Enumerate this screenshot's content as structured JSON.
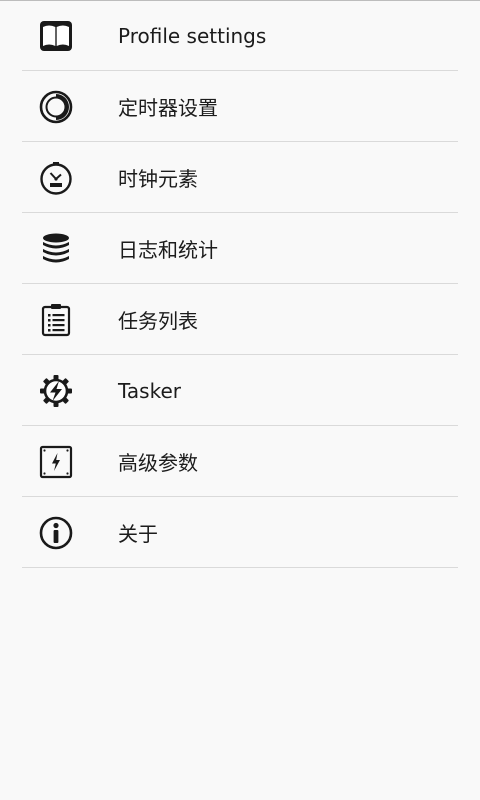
{
  "menu": {
    "items": [
      {
        "label": "Profile settings",
        "icon": "book-icon"
      },
      {
        "label": "定时器设置",
        "icon": "timer-icon"
      },
      {
        "label": "时钟元素",
        "icon": "clock-icon"
      },
      {
        "label": "日志和统计",
        "icon": "database-icon"
      },
      {
        "label": "任务列表",
        "icon": "clipboard-list-icon"
      },
      {
        "label": "Tasker",
        "icon": "tasker-gear-icon"
      },
      {
        "label": "高级参数",
        "icon": "power-panel-icon"
      },
      {
        "label": "关于",
        "icon": "info-icon"
      }
    ]
  },
  "colors": {
    "background": "#f9f9f9",
    "divider": "#dadada",
    "text": "#1c1c1c",
    "icon": "#1a1a1a"
  }
}
